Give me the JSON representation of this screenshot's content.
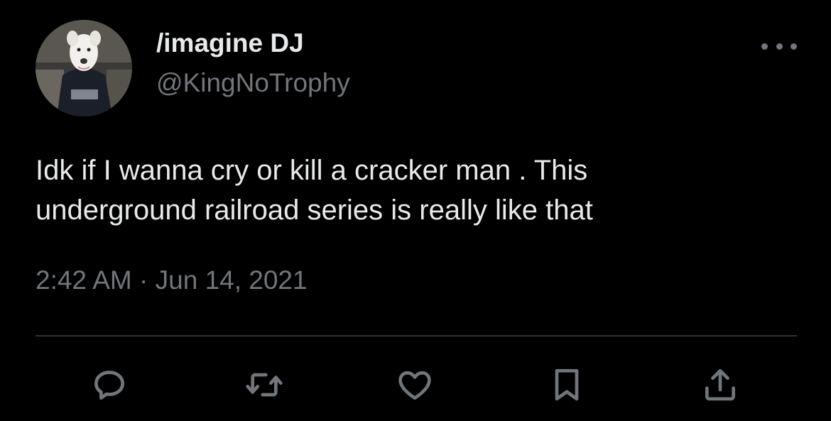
{
  "author": {
    "display_name": "/imagine DJ",
    "handle": "@KingNoTrophy",
    "avatar": "avatar-dog-photo"
  },
  "tweet": {
    "text": "Idk if I wanna cry or kill a cracker man . This\nunderground railroad series is really like that",
    "timestamp": "2:42 AM · Jun 14, 2021"
  },
  "actions": [
    {
      "name": "reply",
      "icon": "reply-bubble-icon"
    },
    {
      "name": "retweet",
      "icon": "retweet-arrows-icon"
    },
    {
      "name": "like",
      "icon": "heart-icon"
    },
    {
      "name": "bookmark",
      "icon": "bookmark-icon"
    },
    {
      "name": "share",
      "icon": "share-upload-icon"
    }
  ],
  "colors": {
    "background": "#000000",
    "primary_text": "#e7e9ea",
    "secondary_text": "#71767b",
    "divider": "#2f3336"
  }
}
